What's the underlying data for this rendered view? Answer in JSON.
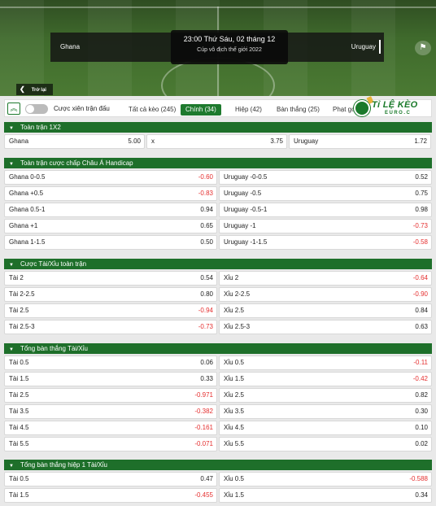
{
  "match": {
    "home": "Ghana",
    "away": "Uruguay",
    "datetime": "23:00 Thứ Sáu, 02 tháng 12",
    "competition": "Cúp vô địch thế giới 2022",
    "back_label": "Trở lại"
  },
  "logo": {
    "brand": "Tỉ LỆ KÈO",
    "sub": "EURO.C"
  },
  "toolbar": {
    "parlay_label": "Cược xiên trận đấu",
    "tabs": [
      {
        "label": "Tất cả kèo (245)",
        "active": false
      },
      {
        "label": "Chính (34)",
        "active": true
      },
      {
        "label": "Hiệp (42)",
        "active": false
      },
      {
        "label": "Bàn thắng (25)",
        "active": false
      },
      {
        "label": "Phạt góc",
        "active": false
      }
    ]
  },
  "sections": [
    {
      "title": "Toàn trận 1X2",
      "layout": "three",
      "rows": [
        [
          {
            "label": "Ghana",
            "odd": "5.00"
          },
          {
            "label": "x",
            "odd": "3.75"
          },
          {
            "label": "Uruguay",
            "odd": "1.72"
          }
        ]
      ]
    },
    {
      "title": "Toàn trận cược chấp Châu Á Handicap",
      "layout": "two",
      "rows": [
        [
          {
            "label": "Ghana 0-0.5",
            "odd": "-0.60"
          },
          {
            "label": "Uruguay -0-0.5",
            "odd": "0.52"
          }
        ],
        [
          {
            "label": "Ghana +0.5",
            "odd": "-0.83"
          },
          {
            "label": "Uruguay -0.5",
            "odd": "0.75"
          }
        ],
        [
          {
            "label": "Ghana 0.5-1",
            "odd": "0.94"
          },
          {
            "label": "Uruguay -0.5-1",
            "odd": "0.98"
          }
        ],
        [
          {
            "label": "Ghana +1",
            "odd": "0.65"
          },
          {
            "label": "Uruguay -1",
            "odd": "-0.73"
          }
        ],
        [
          {
            "label": "Ghana 1-1.5",
            "odd": "0.50"
          },
          {
            "label": "Uruguay -1-1.5",
            "odd": "-0.58"
          }
        ]
      ]
    },
    {
      "title": "Cược Tài/Xỉu toàn trận",
      "layout": "two",
      "rows": [
        [
          {
            "label": "Tài 2",
            "odd": "0.54"
          },
          {
            "label": "Xỉu 2",
            "odd": "-0.64"
          }
        ],
        [
          {
            "label": "Tài 2-2.5",
            "odd": "0.80"
          },
          {
            "label": "Xỉu 2-2.5",
            "odd": "-0.90"
          }
        ],
        [
          {
            "label": "Tài 2.5",
            "odd": "-0.94"
          },
          {
            "label": "Xỉu 2.5",
            "odd": "0.84"
          }
        ],
        [
          {
            "label": "Tài 2.5-3",
            "odd": "-0.73"
          },
          {
            "label": "Xỉu 2.5-3",
            "odd": "0.63"
          }
        ]
      ]
    },
    {
      "title": "Tổng bàn thắng Tài/Xỉu",
      "layout": "two",
      "rows": [
        [
          {
            "label": "Tài 0.5",
            "odd": "0.06"
          },
          {
            "label": "Xỉu 0.5",
            "odd": "-0.11"
          }
        ],
        [
          {
            "label": "Tài 1.5",
            "odd": "0.33"
          },
          {
            "label": "Xỉu 1.5",
            "odd": "-0.42"
          }
        ],
        [
          {
            "label": "Tài 2.5",
            "odd": "-0.971"
          },
          {
            "label": "Xỉu 2.5",
            "odd": "0.82"
          }
        ],
        [
          {
            "label": "Tài 3.5",
            "odd": "-0.382"
          },
          {
            "label": "Xỉu 3.5",
            "odd": "0.30"
          }
        ],
        [
          {
            "label": "Tài 4.5",
            "odd": "-0.161"
          },
          {
            "label": "Xỉu 4.5",
            "odd": "0.10"
          }
        ],
        [
          {
            "label": "Tài 5.5",
            "odd": "-0.071"
          },
          {
            "label": "Xỉu 5.5",
            "odd": "0.02"
          }
        ]
      ]
    },
    {
      "title": "Tổng bàn thắng hiệp 1 Tài/Xỉu",
      "layout": "two",
      "rows": [
        [
          {
            "label": "Tài 0.5",
            "odd": "0.47"
          },
          {
            "label": "Xỉu 0.5",
            "odd": "-0.588"
          }
        ],
        [
          {
            "label": "Tài 1.5",
            "odd": "-0.455"
          },
          {
            "label": "Xỉu 1.5",
            "odd": "0.34"
          }
        ]
      ]
    }
  ]
}
